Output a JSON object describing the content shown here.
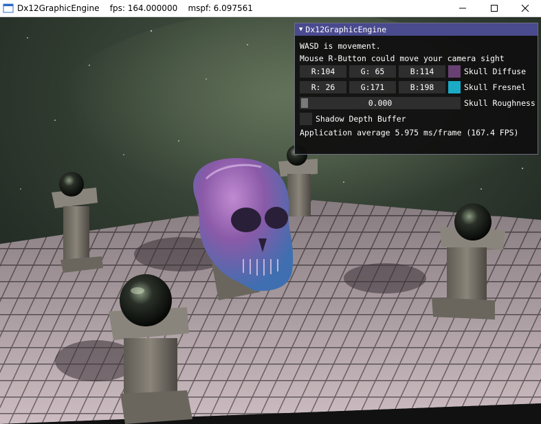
{
  "window": {
    "title": "Dx12GraphicEngine    fps: 164.000000    mspf: 6.097561",
    "controls": {
      "minimize": "minimize-icon",
      "maximize": "maximize-icon",
      "close": "close-icon"
    }
  },
  "panel": {
    "title": "Dx12GraphicEngine",
    "help_line1": "WASD is movement.",
    "help_line2": "Mouse R-Button could move your camera sight",
    "diffuse": {
      "r": "R:104",
      "g": "G: 65",
      "b": "B:114",
      "label": "Skull Diffuse",
      "color": "#684172"
    },
    "fresnel": {
      "r": "R: 26",
      "g": "G:171",
      "b": "B:198",
      "label": "Skull Fresnel",
      "color": "#1aabc6"
    },
    "roughness": {
      "value": "0.000",
      "label": "Skull Roughness",
      "fraction": 0.0
    },
    "shadow": {
      "label": "Shadow Depth Buffer",
      "checked": false
    },
    "stats": "Application average 5.975 ms/frame (167.4 FPS)"
  },
  "colors": {
    "panel_title": "#4a4a8f",
    "frame_bg": "#2e2e2e",
    "accent": "#1aabc6"
  }
}
